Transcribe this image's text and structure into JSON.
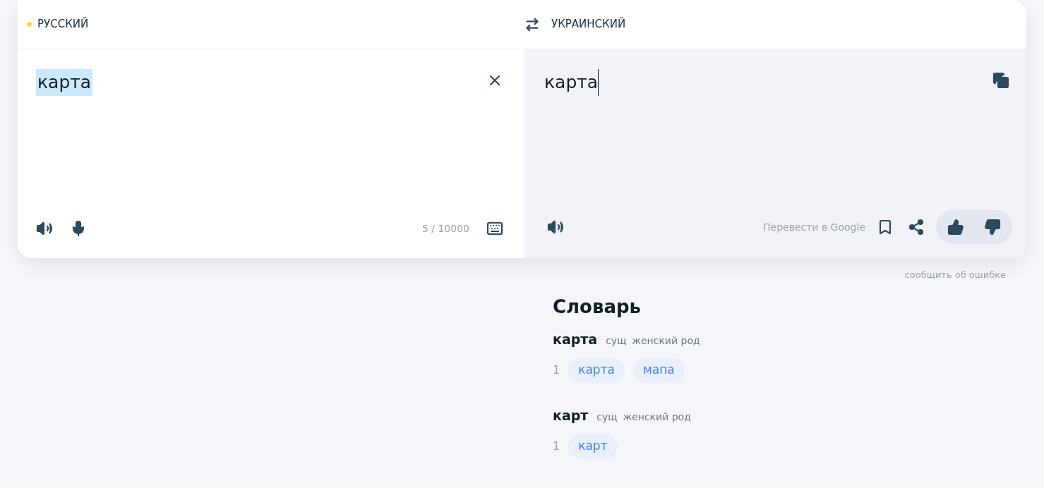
{
  "languages": [
    {
      "label": "РУССКИЙ",
      "detected": true
    },
    {
      "label": "УКРАИНСКИЙ",
      "detected": false
    }
  ],
  "source": {
    "text": "карта",
    "highlighted": true,
    "counter": "5 / 10000"
  },
  "target": {
    "text": "карта",
    "caret": true,
    "google_link": "Перевести в Google"
  },
  "report_link": "сообщить об ошибке",
  "dictionary": {
    "title": "Словарь",
    "entries": [
      {
        "word": "карта",
        "pos": "сущ",
        "gender": "женский род",
        "meanings": [
          {
            "number": "1",
            "translations": [
              "карта",
              "мапа"
            ]
          }
        ]
      },
      {
        "word": "карт",
        "pos": "сущ",
        "gender": "женский род",
        "meanings": [
          {
            "number": "1",
            "translations": [
              "карт"
            ]
          }
        ]
      }
    ]
  }
}
